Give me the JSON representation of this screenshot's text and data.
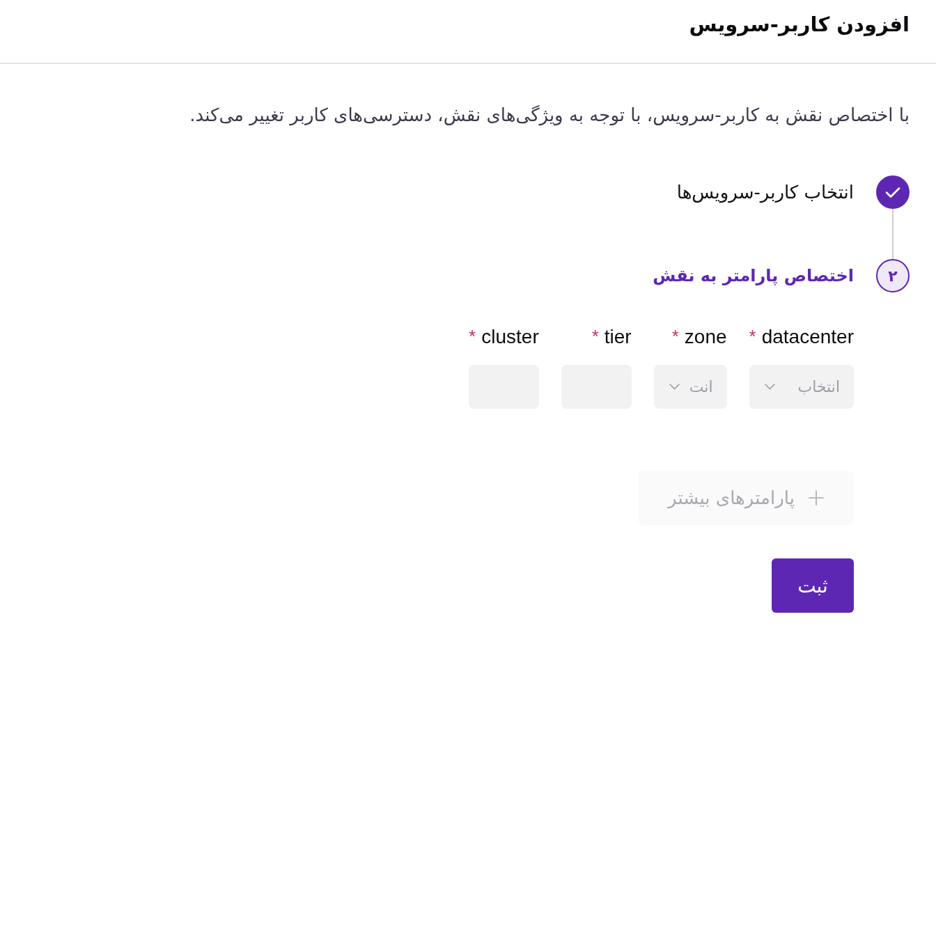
{
  "header": {
    "title": "افزودن کاربر-سرویس"
  },
  "description": "با اختصاص نقش به کاربر-سرویس، با توجه به ویژگی‌های نقش، دسترسی‌های کاربر تغییر می‌کند.",
  "steps": [
    {
      "label": "انتخاب کاربر-سرویس‌ها",
      "completed": true,
      "current": false
    },
    {
      "number": "۲",
      "label": "اختصاص پارامتر به نقش",
      "completed": false,
      "current": true
    }
  ],
  "parameters": [
    {
      "label": "datacenter",
      "required_mark": "*",
      "kind": "select",
      "placeholder": "انتخاب"
    },
    {
      "label": "zone",
      "required_mark": "*",
      "kind": "select",
      "placeholder": "انت"
    },
    {
      "label": "tier",
      "required_mark": "*",
      "kind": "input"
    },
    {
      "label": "cluster",
      "required_mark": "*",
      "kind": "input"
    }
  ],
  "more_parameters_button": {
    "label": "پارامترهای بیشتر",
    "disabled": true
  },
  "submit_button": {
    "label": "ثبت"
  }
}
